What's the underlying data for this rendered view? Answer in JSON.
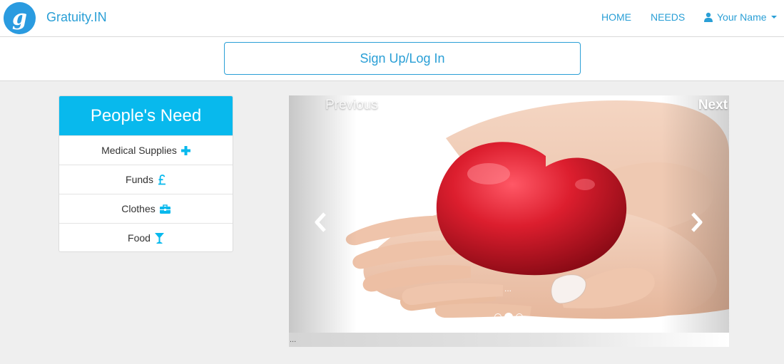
{
  "navbar": {
    "logo_letter": "g",
    "brand": "Gratuity.IN",
    "links": [
      {
        "label": "HOME"
      },
      {
        "label": "NEEDS"
      }
    ],
    "user": {
      "label": "Your Name",
      "icon": "user-icon"
    }
  },
  "signup": {
    "label": "Sign Up/Log In"
  },
  "panel": {
    "title": "People's Need",
    "items": [
      {
        "label": "Medical Supplies",
        "icon": "plus-icon"
      },
      {
        "label": "Funds",
        "icon": "pound-icon"
      },
      {
        "label": "Clothes",
        "icon": "briefcase-icon"
      },
      {
        "label": "Food",
        "icon": "glass-icon"
      }
    ]
  },
  "carousel": {
    "prev_label": "Previous",
    "next_label": "Next",
    "caption": "...",
    "footer": "...",
    "slides": 3,
    "active_slide": 2,
    "image": "hands-holding-red-heart"
  },
  "colors": {
    "accent": "#2a9fd6",
    "panel_heading": "#08b9ed",
    "heart": "#d81e2c",
    "background": "#efefef"
  }
}
